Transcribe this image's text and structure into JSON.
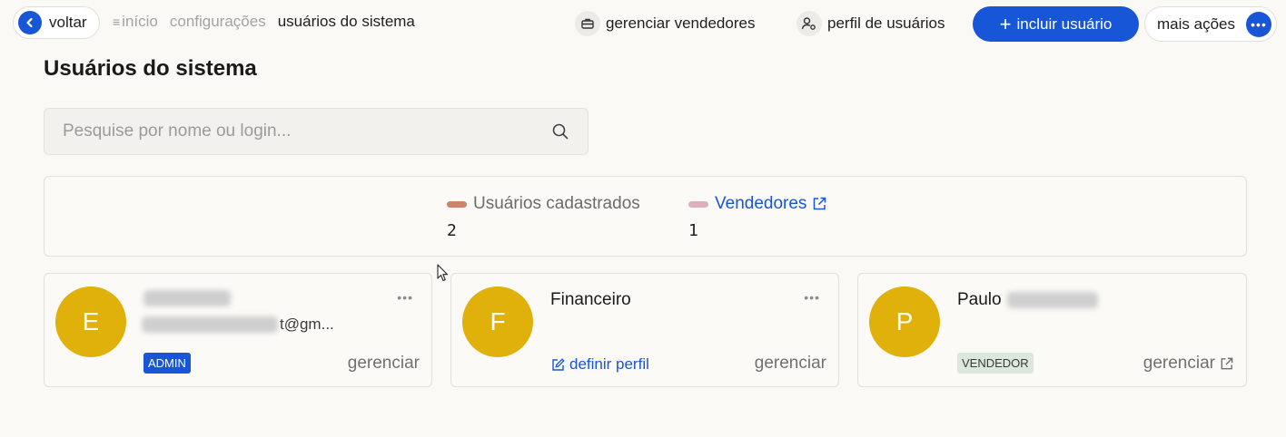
{
  "header": {
    "back_label": "voltar",
    "breadcrumbs": [
      "início",
      "configurações"
    ],
    "current_page": "usuários do sistema",
    "manage_sellers_label": "gerenciar vendedores",
    "user_profile_label": "perfil de usuários",
    "add_user_label": "incluir usuário",
    "more_actions_label": "mais ações"
  },
  "page": {
    "title": "Usuários do sistema",
    "search_placeholder": "Pesquise por nome ou login..."
  },
  "stats": {
    "registered_label": "Usuários cadastrados",
    "registered_value": "2",
    "sellers_label": "Vendedores",
    "sellers_value": "1",
    "colors": {
      "registered": "#c9876a",
      "sellers": "#ddb0bd"
    }
  },
  "cards": [
    {
      "initial": "E",
      "email_suffix": "t@gm...",
      "badge": "ADMIN",
      "action": "gerenciar"
    },
    {
      "initial": "F",
      "name": "Financeiro",
      "define_label": "definir perfil",
      "action": "gerenciar"
    },
    {
      "initial": "P",
      "name": "Paulo",
      "badge": "VENDEDOR",
      "action": "gerenciar"
    }
  ],
  "colors": {
    "accent": "#1756d6",
    "avatar": "#dfb10a",
    "background": "#faf9f6"
  }
}
